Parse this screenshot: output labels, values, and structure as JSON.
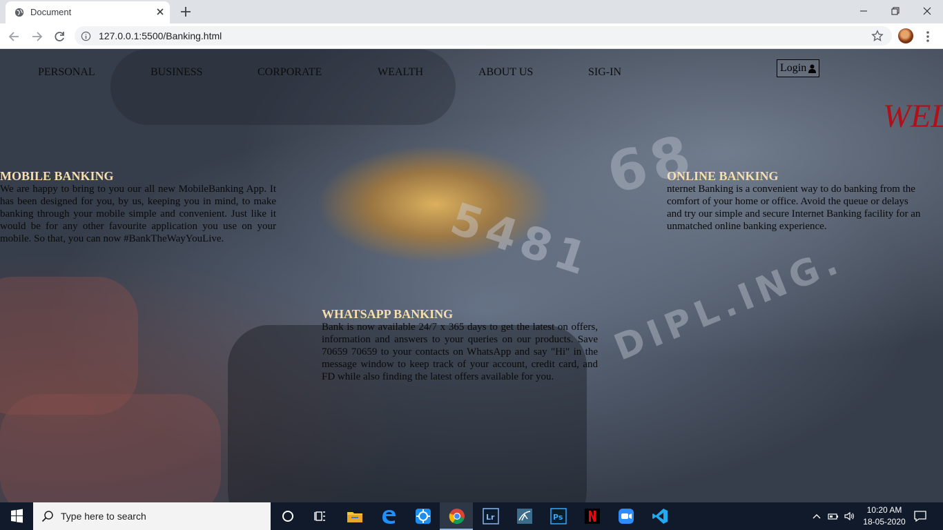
{
  "browser": {
    "tab_title": "Document",
    "url": "127.0.0.1:5500/Banking.html"
  },
  "nav": {
    "items": [
      "PERSONAL",
      "BUSINESS",
      "CORPORATE",
      "WEALTH",
      "ABOUT US",
      "SIG-IN"
    ],
    "login_label": "Login"
  },
  "welcome_text": "WEL",
  "sections": {
    "mobile": {
      "title": "MOBILE BANKING",
      "body": "We are happy to bring to you our all new MobileBanking App. It has been designed for you, by us, keeping you in mind, to make banking through your mobile simple and convenient. Just like it would be for any other favourite application you use on your mobile. So that, you can now #BankTheWayYouLive."
    },
    "online": {
      "title": "ONLINE BANKING",
      "lines": [
        "nternet Banking is a convenient way to do banking from the",
        "comfort of your home or office. Avoid the queue or delays",
        "and try our simple and secure Internet Banking facility for an",
        "unmatched online banking experience."
      ]
    },
    "whatsapp": {
      "title": "WHATSAPP BANKING",
      "body": "Bank is now available 24/7 x 365 days to get the latest on offers, information and answers to your queries on our products. Save 70659 70659 to your contacts on WhatsApp and say \"Hi\" in the message window to keep track of your account, credit card, and FD while also finding the latest offers available for you."
    }
  },
  "taskbar": {
    "search_placeholder": "Type here to search",
    "time": "10:20 AM",
    "date": "18-05-2020"
  },
  "colors": {
    "section_title": "#f6ddb2",
    "welcome": "#b01018",
    "taskbar": "#101a2a"
  }
}
